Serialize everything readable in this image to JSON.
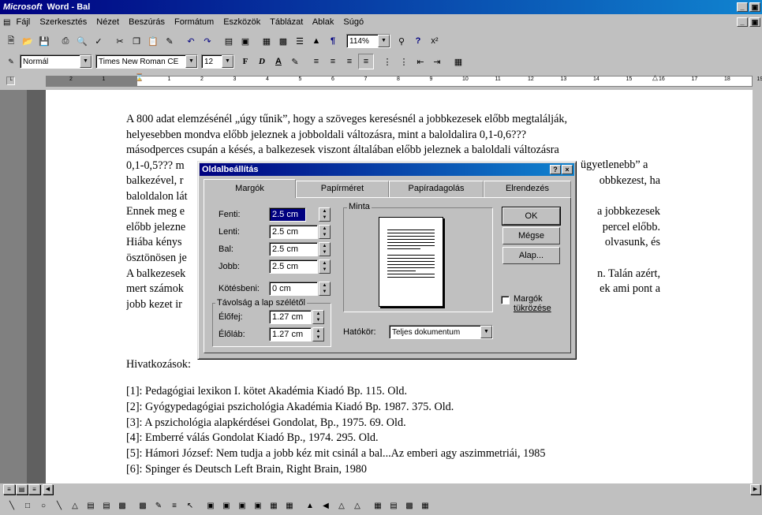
{
  "window": {
    "brand": "Microsoft",
    "title": " Word - Bal",
    "controls": [
      "_",
      "×"
    ]
  },
  "menu": [
    "Fájl",
    "Szerkesztés",
    "Nézet",
    "Beszúrás",
    "Formátum",
    "Eszközök",
    "Táblázat",
    "Ablak",
    "Súgó"
  ],
  "toolbar": {
    "zoom": "114%"
  },
  "format_toolbar": {
    "style": "Normál",
    "font": "Times New Roman CE",
    "size": "12",
    "bold": "F",
    "italic": "D",
    "underline": "A"
  },
  "ruler": {
    "numbers": [
      "2",
      "1",
      "1",
      "2",
      "3",
      "4",
      "5",
      "6",
      "7",
      "8",
      "9",
      "10",
      "11",
      "12",
      "13",
      "14",
      "15",
      "16",
      "17",
      "18",
      "19"
    ]
  },
  "document": {
    "lines_top": [
      "A 800 adat elemzésénél „úgy tűnik”, hogy a szöveges keresésnél a jobbkezesek előbb megtalálják,",
      "helyesebben mondva előbb jeleznek a jobboldali változásra, mint a baloldalira 0,1-0,6???",
      "másodperces csupán a késés, a balkezesek viszont általában előbb jeleznek a baloldali változásra",
      "0,1-0,5??? m"
    ],
    "line3_right": "ügyetlenebb” a",
    "left_fragments": [
      "balkezével, r",
      "baloldalon lát",
      "Ennek meg e",
      "előbb jelezne",
      "Hiába kénys",
      "ösztönösen je",
      "A balkezesek",
      "mert számok",
      "jobb kezet ir"
    ],
    "right_fragments": [
      "obbkezest, ha",
      "",
      "a jobbkezesek",
      "percel előbb.",
      "olvasunk, és",
      "",
      "n. Talán azért,",
      "ek ami pont a",
      ""
    ],
    "references_heading": "Hivatkozások:",
    "references": [
      "[1]: Pedagógiai lexikon I. kötet Akadémia Kiadó Bp. 115. Old.",
      "[2]: Gyógypedagógiai pszichológia Akadémia Kiadó Bp. 1987. 375. Old.",
      "[3]: A pszichológia alapkérdései Gondolat, Bp., 1975. 69. Old.",
      "[4]: Emberré válás Gondolat Kiadó Bp., 1974. 295. Old.",
      "[5]: Hámori József: Nem tudja a jobb kéz mit csinál a bal...Az emberi agy aszimmetriái, 1985",
      "[6]: Spinger és Deutsch Left Brain, Right Brain, 1980"
    ]
  },
  "dialog": {
    "title": "Oldalbeállítás",
    "help": "?",
    "close": "×",
    "tabs": [
      "Margók",
      "Papírméret",
      "Papíradagolás",
      "Elrendezés"
    ],
    "fields": {
      "top": {
        "label": "Fenti:",
        "value": "2.5 cm"
      },
      "bottom": {
        "label": "Lenti:",
        "value": "2.5 cm"
      },
      "left": {
        "label": "Bal:",
        "value": "2.5 cm"
      },
      "right": {
        "label": "Jobb:",
        "value": "2.5 cm"
      },
      "gutter": {
        "label": "Kötésbeni:",
        "value": "0 cm"
      }
    },
    "distance_group": "Távolság a lap szélétől",
    "header": {
      "label": "Élőfej:",
      "value": "1.27 cm"
    },
    "footer": {
      "label": "Élőláb:",
      "value": "1.27 cm"
    },
    "preview_label": "Minta",
    "apply_label": "Hatókör:",
    "apply_value": "Teljes dokumentum",
    "mirror_label_1": "Margók",
    "mirror_label_2": "tükrözése",
    "ok": "OK",
    "cancel": "Mégse",
    "default": "Alap..."
  }
}
